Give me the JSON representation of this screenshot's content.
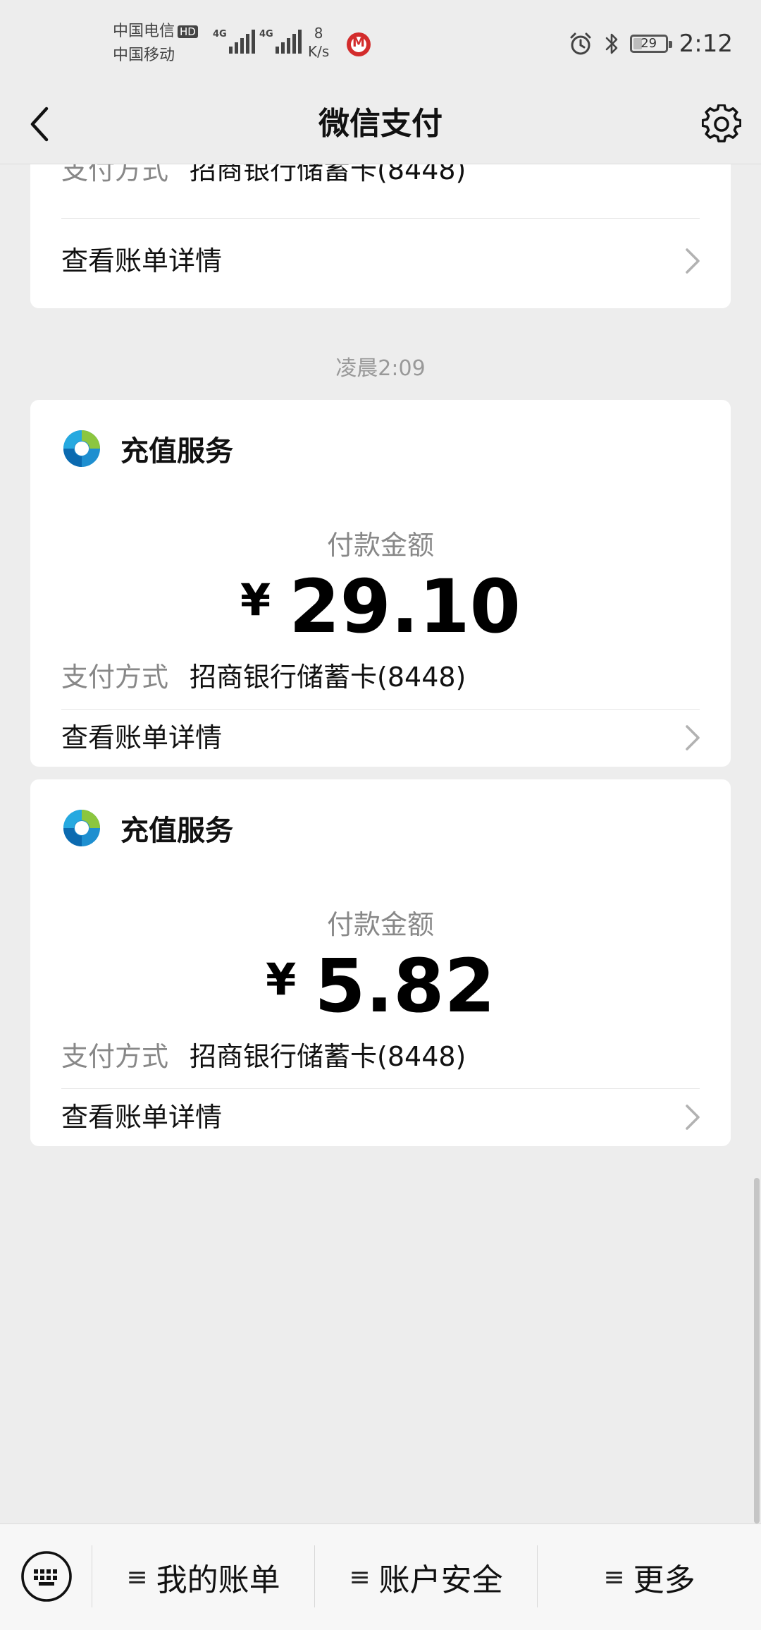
{
  "status_bar": {
    "carrier_1": "中国电信",
    "hd_badge": "HD",
    "carrier_2": "中国移动",
    "signal_1_label": "4G",
    "signal_2_label": "4G",
    "net_speed_value": "8",
    "net_speed_unit": "K/s",
    "battery": "29",
    "battery_level_percent": 29,
    "time": "2:12"
  },
  "nav": {
    "title": "微信支付",
    "back_icon": "chevron-left-icon",
    "settings_icon": "gear-icon"
  },
  "labels": {
    "amount_label": "付款金额",
    "payment_method_label": "支付方式",
    "view_details": "查看账单详情",
    "currency_symbol": "¥"
  },
  "partial_card": {
    "payment_method": "招商银行储蓄卡(8448)"
  },
  "time_separator": "凌晨2:09",
  "transactions": [
    {
      "merchant": "充值服务",
      "amount": "29.10",
      "payment_method": "招商银行储蓄卡(8448)"
    },
    {
      "merchant": "充值服务",
      "amount": "5.82",
      "payment_method": "招商银行储蓄卡(8448)"
    }
  ],
  "bottom_menu": {
    "keyboard_icon": "keyboard-icon",
    "items": [
      {
        "glyph": "≡",
        "label": "我的账单"
      },
      {
        "glyph": "≡",
        "label": "账户安全"
      },
      {
        "glyph": "≡",
        "label": "更多"
      }
    ]
  },
  "colors": {
    "background": "#ededed",
    "card": "#ffffff",
    "primary_text": "#111111",
    "secondary_text": "#888888",
    "bottom_bar": "#f7f7f7"
  }
}
